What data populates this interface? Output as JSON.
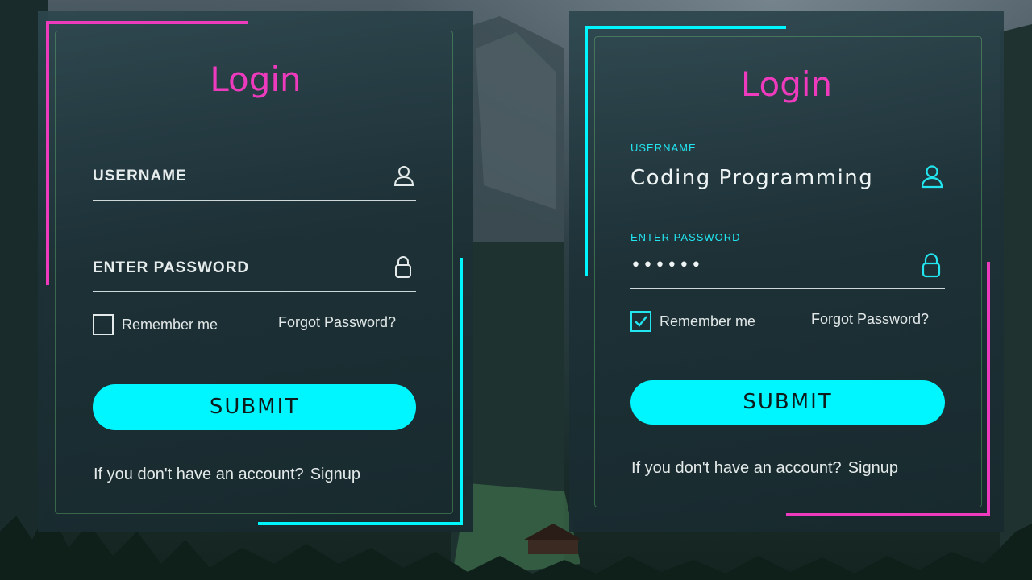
{
  "colors": {
    "title": "#ee3bbd",
    "accent_pink": "#ee3bbd",
    "accent_cyan": "#00f6ff",
    "button": "#00f6ff"
  },
  "left_card": {
    "title": "Login",
    "username_label": "USERNAME",
    "password_label": "ENTER PASSWORD",
    "username_icon": "user-icon",
    "password_icon": "lock-icon",
    "remember_label": "Remember me",
    "remember_checked": false,
    "forgot_label": "Forgot Password?",
    "submit_label": "SUBMIT",
    "signup_prompt": "If you don't have an account?",
    "signup_link": "Signup"
  },
  "right_card": {
    "title": "Login",
    "username_label": "USERNAME",
    "username_value": "Coding Programming",
    "password_label": "ENTER PASSWORD",
    "password_value": "••••••",
    "username_icon": "user-icon",
    "password_icon": "lock-icon",
    "remember_label": "Remember me",
    "remember_checked": true,
    "forgot_label": "Forgot Password?",
    "submit_label": "SUBMIT",
    "signup_prompt": "If you don't have an account?",
    "signup_link": "Signup"
  }
}
